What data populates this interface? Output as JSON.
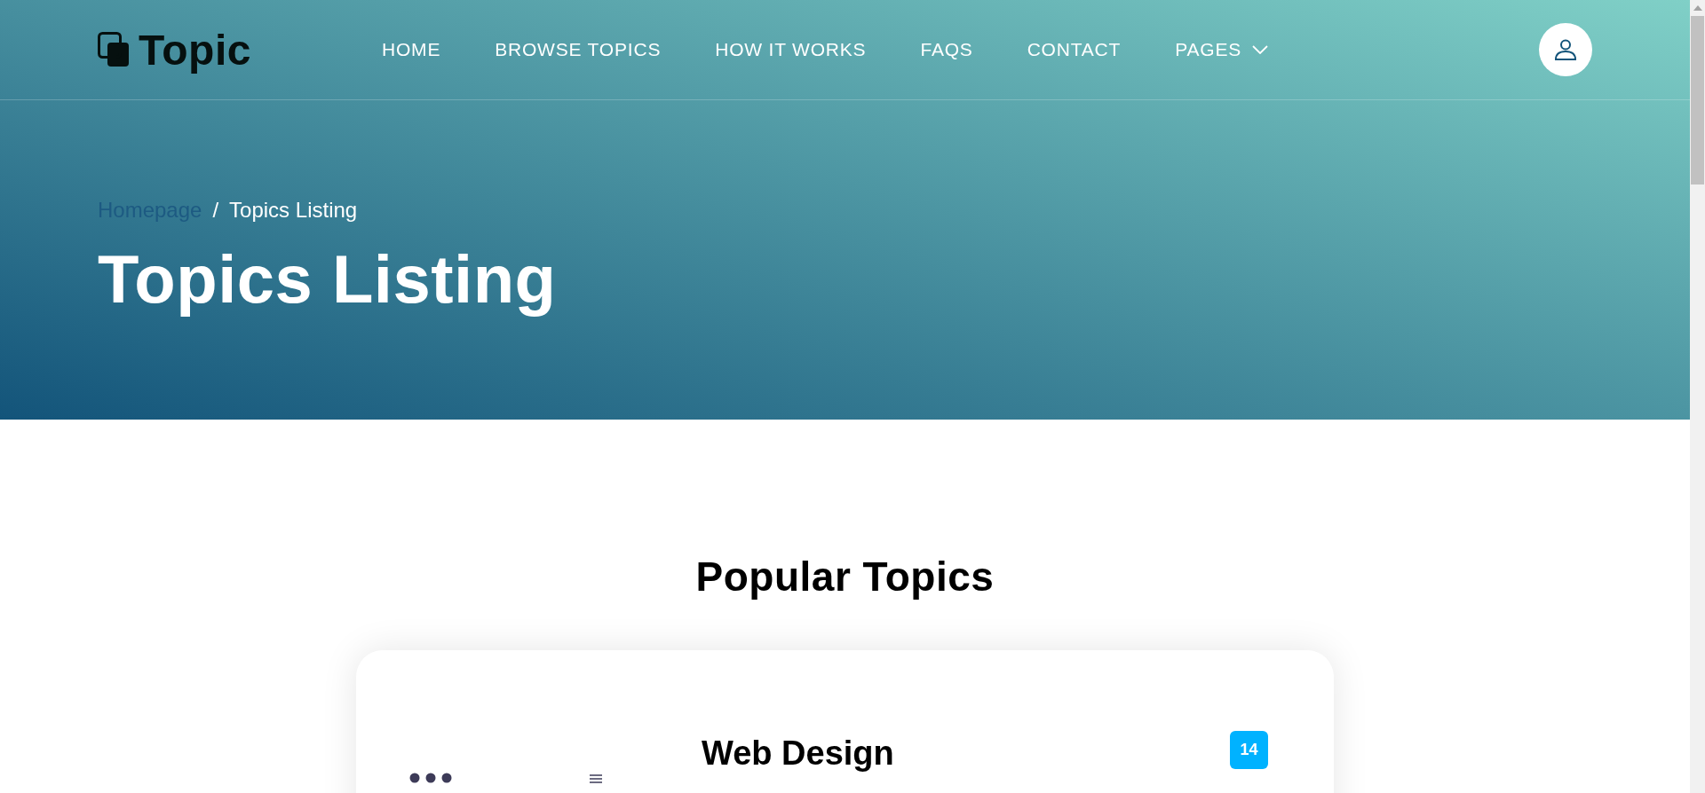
{
  "brand": {
    "name": "Topic"
  },
  "nav": [
    {
      "label": "HOME",
      "kind": "link"
    },
    {
      "label": "BROWSE TOPICS",
      "kind": "link"
    },
    {
      "label": "HOW IT WORKS",
      "kind": "link"
    },
    {
      "label": "FAQS",
      "kind": "link"
    },
    {
      "label": "CONTACT",
      "kind": "link"
    },
    {
      "label": "PAGES",
      "kind": "dropdown"
    }
  ],
  "breadcrumb": {
    "separator": "/",
    "items": [
      {
        "label": "Homepage",
        "selected": false
      },
      {
        "label": "Topics Listing",
        "selected": true
      }
    ]
  },
  "hero": {
    "title": "Topics Listing"
  },
  "section": {
    "title": "Popular Topics"
  },
  "topics": [
    {
      "title": "Web Design",
      "count": "14"
    }
  ]
}
